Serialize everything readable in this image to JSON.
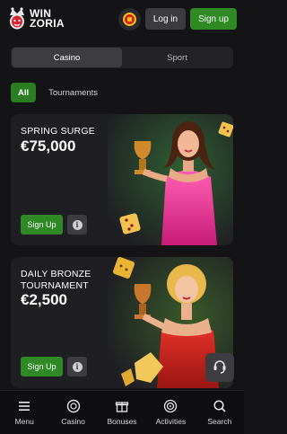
{
  "header": {
    "logo_line1": "WIN",
    "logo_line2": "ZORIA",
    "login_label": "Log in",
    "signup_label": "Sign up"
  },
  "segment": {
    "tabs": [
      {
        "label": "Casino",
        "active": true
      },
      {
        "label": "Sport",
        "active": false
      }
    ]
  },
  "filters": {
    "all_label": "All",
    "tournaments_label": "Tournaments"
  },
  "promos": [
    {
      "title_line1": "SPRING SURGE",
      "title_line2": "",
      "amount": "€75,000",
      "signup_label": "Sign Up"
    },
    {
      "title_line1": "DAILY BRONZE",
      "title_line2": "TOURNAMENT",
      "amount": "€2,500",
      "signup_label": "Sign Up"
    }
  ],
  "bottom_nav": [
    {
      "label": "Menu",
      "icon": "menu-icon"
    },
    {
      "label": "Casino",
      "icon": "casino-chip-icon"
    },
    {
      "label": "Bonuses",
      "icon": "gift-icon"
    },
    {
      "label": "Activities",
      "icon": "target-icon"
    },
    {
      "label": "Search",
      "icon": "search-icon"
    }
  ],
  "colors": {
    "accent_green": "#2f8a26",
    "background": "#141417",
    "card": "#1f1f23"
  }
}
